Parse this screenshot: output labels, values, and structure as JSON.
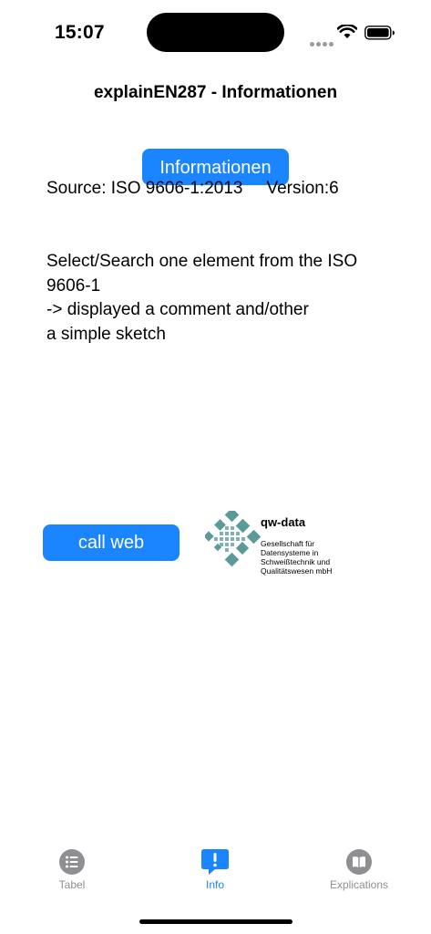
{
  "status_bar": {
    "time": "15:07"
  },
  "nav": {
    "title": "explainEN287 - Informationen"
  },
  "main": {
    "info_button_label": "Informationen",
    "source_label": "Source: ISO 9606-1:2013",
    "version_label": "Version:6",
    "description_lines": [
      "Select/Search one element from the ISO",
      "9606-1",
      "->  displayed a comment and/other",
      "a simple sketch"
    ],
    "call_web_label": "call web"
  },
  "logo": {
    "name": "qw-data",
    "subtitle_lines": [
      "Gesellschaft für",
      "Datensysteme in",
      "Schweißtechnik und",
      "Qualitätswesen mbH"
    ],
    "color": "#5c9a9a"
  },
  "tab_bar": {
    "items": [
      {
        "label": "Tabel",
        "icon": "list-icon"
      },
      {
        "label": "Info",
        "icon": "exclamation-bubble-icon"
      },
      {
        "label": "Explications",
        "icon": "book-icon"
      }
    ],
    "active_index": 1
  },
  "colors": {
    "accent": "#1a85ff",
    "inactive": "#8e8e93"
  }
}
